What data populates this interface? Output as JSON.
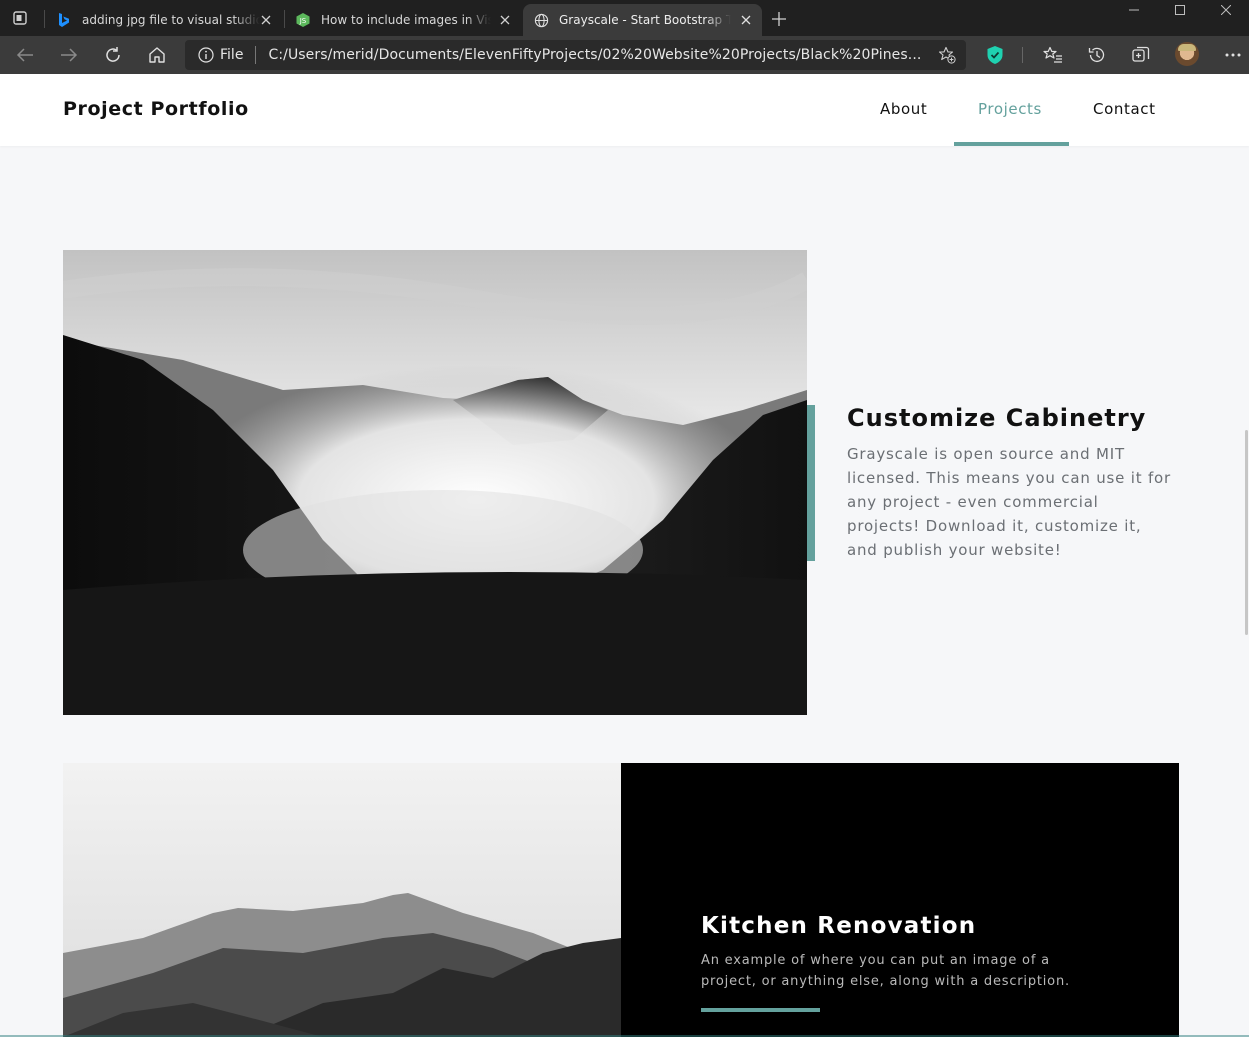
{
  "browser": {
    "tabs": [
      {
        "title": "adding jpg file to visual studio code",
        "favicon": "bing-icon"
      },
      {
        "title": "How to include images in Visual Studio Code",
        "favicon": "script-icon"
      },
      {
        "title": "Grayscale - Start Bootstrap Theme",
        "favicon": "globe-icon",
        "active": true
      }
    ],
    "address": {
      "scheme_label": "File",
      "url": "C:/Users/merid/Documents/ElevenFiftyProjects/02%20Website%20Projects/Black%20Pines..."
    }
  },
  "navbar": {
    "brand": "Project Portfolio",
    "links": [
      {
        "label": "About"
      },
      {
        "label": "Projects",
        "active": true
      },
      {
        "label": "Contact"
      }
    ]
  },
  "featured": {
    "title": "Customize Cabinetry",
    "description": "Grayscale is open source and MIT licensed. This means you can use it for any project - even commercial projects! Download it, customize it, and publish your website!"
  },
  "project": {
    "title": "Kitchen Renovation",
    "description": "An example of where you can put an image of a project, or anything else, along with a description."
  },
  "colors": {
    "accent": "#64a19d",
    "chrome_dark": "#202020",
    "chrome_toolbar": "#3b3b3b",
    "page_bg": "#f6f7f9"
  }
}
